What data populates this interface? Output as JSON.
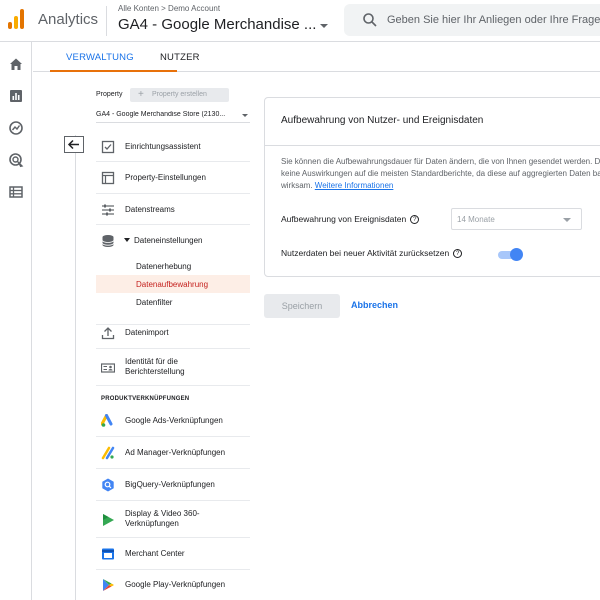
{
  "header": {
    "app_name": "Analytics",
    "breadcrumb": "Alle Konten > Demo Account",
    "property_title": "GA4 - Google Merchandise ...",
    "search_placeholder": "Geben Sie hier Ihr Anliegen oder Ihre Frage ein"
  },
  "rail": {
    "icons": [
      "home-icon",
      "reports-icon",
      "explore-icon",
      "advertising-icon",
      "configure-icon"
    ]
  },
  "tabs": [
    {
      "label": "VERWALTUNG",
      "active": true
    },
    {
      "label": "NUTZER",
      "active": false
    }
  ],
  "nav": {
    "property_label": "Property",
    "create_property": "Property erstellen",
    "property_select": "GA4 - Google Merchandise Store (2130...",
    "items": [
      {
        "label": "Einrichtungsassistent",
        "icon": "checklist-icon"
      },
      {
        "label": "Property-Einstellungen",
        "icon": "settings-page-icon"
      },
      {
        "label": "Datenstreams",
        "icon": "streams-icon"
      },
      {
        "label": "Dateneinstellungen",
        "icon": "database-icon"
      },
      {
        "label": "Datenimport",
        "icon": "upload-icon"
      },
      {
        "label": "Identität für die Berichterstellung",
        "icon": "identity-icon"
      }
    ],
    "sub_items": [
      "Datenerhebung",
      "Datenaufbewahrung",
      "Datenfilter"
    ],
    "section_heading": "PRODUKTVERKNÜPFUNGEN",
    "links": [
      {
        "label": "Google Ads-Verknüpfungen",
        "icon": "google-ads-icon"
      },
      {
        "label": "Ad Manager-Verknüpfungen",
        "icon": "ad-manager-icon"
      },
      {
        "label": "BigQuery-Verknüpfungen",
        "icon": "bigquery-icon"
      },
      {
        "label": "Display & Video 360-Verknüpfungen",
        "icon": "dv360-icon"
      },
      {
        "label": "Merchant Center",
        "icon": "merchant-center-icon"
      },
      {
        "label": "Google Play-Verknüpfungen",
        "icon": "google-play-icon"
      }
    ]
  },
  "card": {
    "title": "Aufbewahrung von Nutzer- und Ereignisdaten",
    "desc_line1": "Sie können die Aufbewahrungsdauer für Daten ändern, die von Ihnen gesendet werden. Dies hat",
    "desc_line2": "keine Auswirkungen auf die meisten Standardberichte, da diese auf aggregierten Daten basieren.",
    "desc_line3": "wirksam.",
    "more_info": "Weitere Informationen",
    "event_retention_label": "Aufbewahrung von Ereignisdaten",
    "event_retention_value": "14 Monate",
    "reset_label": "Nutzerdaten bei neuer Aktivität zurücksetzen",
    "reset_on": true
  },
  "actions": {
    "save": "Speichern",
    "cancel": "Abbrechen"
  },
  "colors": {
    "accent": "#1a73e8",
    "tab_underline": "#e8710a",
    "active_sub": "#c5221f"
  }
}
